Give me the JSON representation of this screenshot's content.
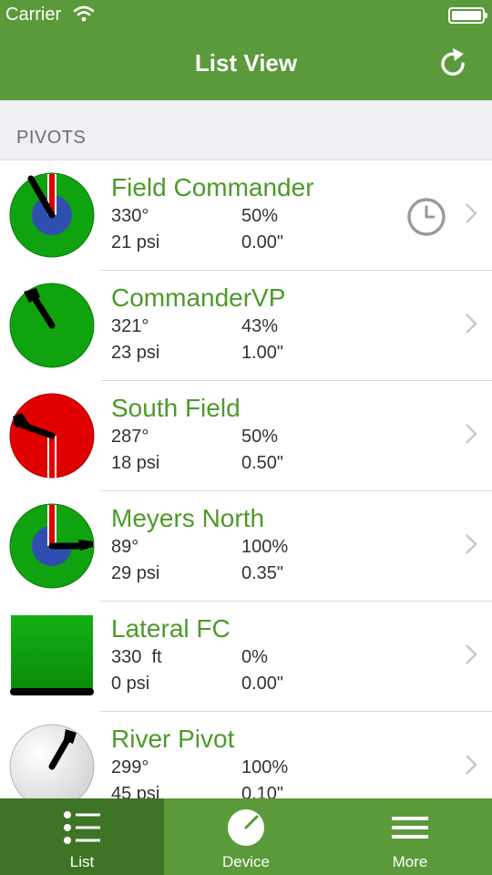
{
  "status_bar": {
    "carrier": "Carrier"
  },
  "nav": {
    "title": "List View"
  },
  "section": {
    "label": "PIVOTS"
  },
  "pivots": [
    {
      "name": "Field Commander",
      "angle": "330°",
      "percent": "50%",
      "pressure": "21 psi",
      "depth": "0.00\"",
      "status": "running",
      "icon": "pivot-green-running",
      "has_clock": true
    },
    {
      "name": "CommanderVP",
      "angle": "321°",
      "percent": "43%",
      "pressure": "23 psi",
      "depth": "1.00\"",
      "status": "running",
      "icon": "pivot-green",
      "has_clock": false
    },
    {
      "name": "South Field",
      "angle": "287°",
      "percent": "50%",
      "pressure": "18 psi",
      "depth": "0.50\"",
      "status": "alarm",
      "icon": "pivot-red",
      "has_clock": false
    },
    {
      "name": "Meyers North",
      "angle": "89°",
      "percent": "100%",
      "pressure": "29 psi",
      "depth": "0.35\"",
      "status": "running",
      "icon": "pivot-green-running",
      "has_clock": false
    },
    {
      "name": "Lateral FC",
      "angle": "330  ft",
      "percent": "0%",
      "pressure": "0 psi",
      "depth": "0.00\"",
      "status": "lateral",
      "icon": "lateral-green",
      "has_clock": false
    },
    {
      "name": "River Pivot",
      "angle": "299°",
      "percent": "100%",
      "pressure": "45 psi",
      "depth": "0.10\"",
      "status": "off",
      "icon": "pivot-gray",
      "has_clock": false
    }
  ],
  "tabs": [
    {
      "label": "List",
      "icon": "list-icon",
      "active": true
    },
    {
      "label": "Device",
      "icon": "device-gauge-icon",
      "active": false
    },
    {
      "label": "More",
      "icon": "menu-icon",
      "active": false
    }
  ],
  "colors": {
    "brand_green": "#5a9a3a",
    "active_tab": "#3d7425",
    "name_green": "#4d9a2a",
    "pivot_green": "#10a010",
    "pivot_red": "#e10000",
    "pivot_blue": "#2f4fb0"
  }
}
